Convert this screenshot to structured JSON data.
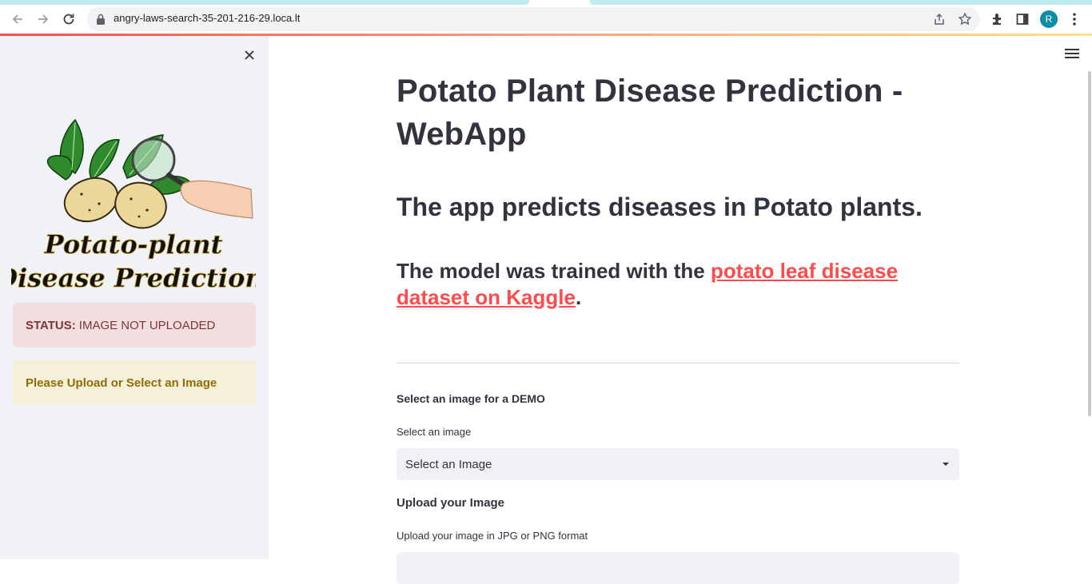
{
  "browser": {
    "url": "angry-laws-search-35-201-216-29.loca.lt",
    "profile_initial": "R",
    "icons": [
      "back-icon",
      "forward-icon",
      "reload-icon",
      "lock-icon",
      "share-icon",
      "star-icon",
      "extensions-icon",
      "side-panel-icon",
      "more-vert-icon"
    ]
  },
  "sidebar": {
    "logo_text_line1": "Potato-plant",
    "logo_text_line2": "Disease Prediction",
    "status_label": "STATUS:",
    "status_value": "IMAGE NOT UPLOADED",
    "warning": "Please Upload or Select an Image"
  },
  "main": {
    "title": "Potato Plant Disease Prediction - WebApp",
    "subtitle": "The app predicts diseases in Potato plants.",
    "model_text_before": "The model was trained with the ",
    "model_link": "potato leaf disease dataset on Kaggle",
    "model_text_after": ".",
    "demo_section_label": "Select an image for a DEMO",
    "select_label": "Select an image",
    "select_value": "Select an Image",
    "upload_section_label": "Upload your Image",
    "upload_help": "Upload your image in JPG or PNG format"
  },
  "colors": {
    "accent": "#ff4b4b",
    "sidebar_bg": "#f0f2f6",
    "error_bg": "#f2dedf",
    "warning_bg": "#f4f0d9",
    "text": "#31333f"
  }
}
